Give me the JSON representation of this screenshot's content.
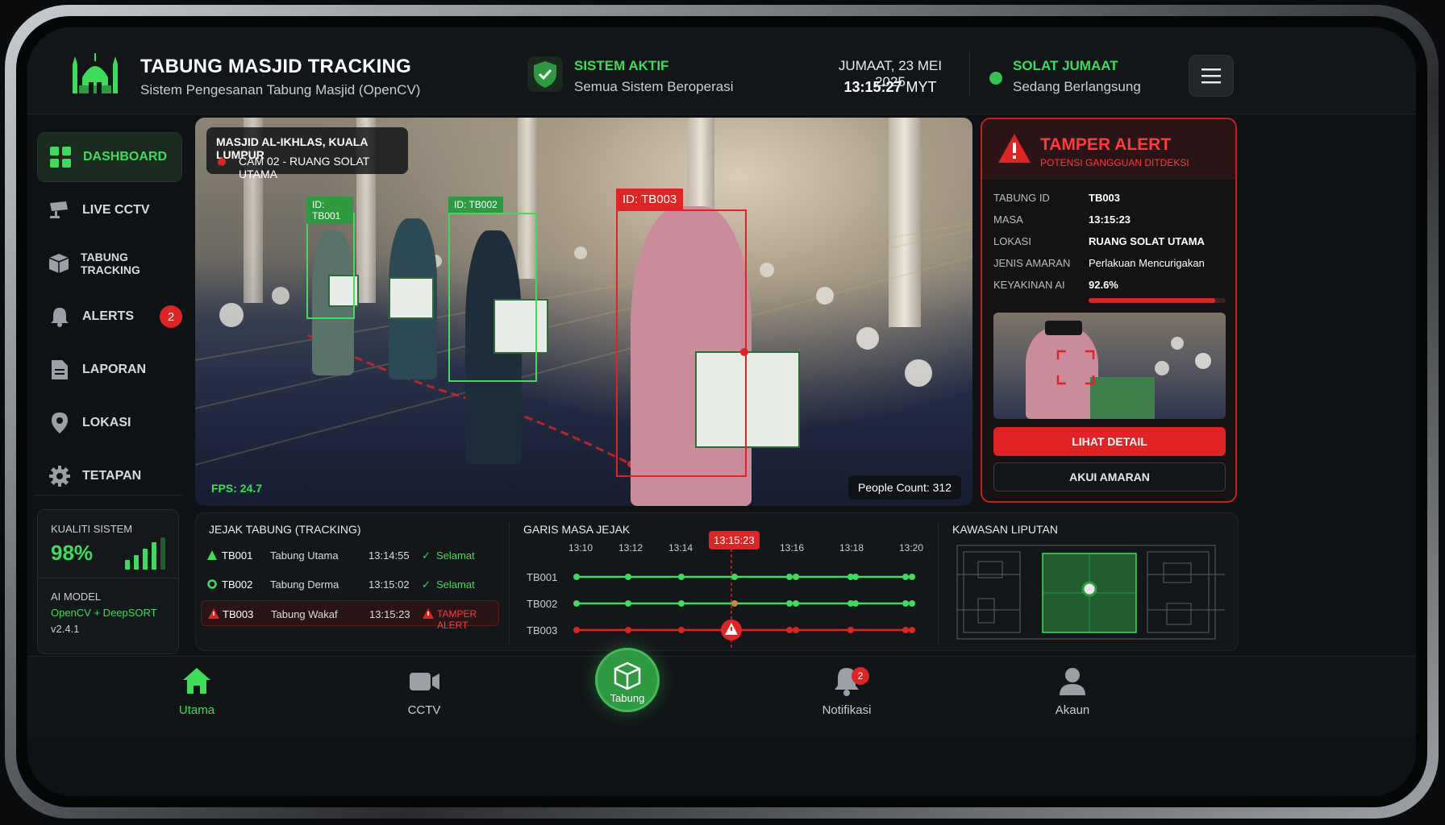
{
  "header": {
    "title": "TABUNG MASJID TRACKING",
    "subtitle": "Sistem Pengesanan Tabung Masjid (OpenCV)",
    "system_status": "SISTEM AKTIF",
    "system_status_sub": "Semua Sistem Beroperasi",
    "date": "JUMAAT, 23 MEI 2025",
    "time": "13:15:27",
    "timezone": "MYT",
    "prayer_status": "SOLAT JUMAAT",
    "prayer_sub": "Sedang Berlangsung"
  },
  "sidebar": {
    "items": [
      {
        "label": "DASHBOARD",
        "icon": "grid-icon",
        "active": true
      },
      {
        "label": "LIVE CCTV",
        "icon": "cctv-camera-icon"
      },
      {
        "label": "TABUNG TRACKING",
        "icon": "box-icon"
      },
      {
        "label": "ALERTS",
        "icon": "bell-icon",
        "badge": "2"
      },
      {
        "label": "LAPORAN",
        "icon": "document-icon"
      },
      {
        "label": "LOKASI",
        "icon": "location-pin-icon"
      },
      {
        "label": "TETAPAN",
        "icon": "gear-icon"
      }
    ],
    "quality_label": "KUALITI SISTEM",
    "quality_value": "98%",
    "ai_label": "AI MODEL",
    "ai_value": "OpenCV + DeepSORT",
    "ai_version": "v2.4.1"
  },
  "camera": {
    "location": "MASJID AL-IKHLAS, KUALA LUMPUR",
    "cam_id": "CAM 02 - RUANG SOLAT UTAMA",
    "boxes": [
      {
        "tag": "ID: TB001"
      },
      {
        "tag": "ID: TB002"
      },
      {
        "tag": "ID: TB003"
      }
    ],
    "fps": "FPS: 24.7",
    "people_count": "People Count: 312"
  },
  "alert": {
    "title": "TAMPER ALERT",
    "subtitle": "POTENSI GANGGUAN DITDEKSI",
    "fields": [
      {
        "key": "TABUNG ID",
        "value": "TB003"
      },
      {
        "key": "MASA",
        "value": "13:15:23"
      },
      {
        "key": "LOKASI",
        "value": "RUANG SOLAT UTAMA"
      },
      {
        "key": "JENIS AMARAN",
        "value": "Perlakuan Mencurigakan"
      },
      {
        "key": "KEYAKINAN AI",
        "value": "92.6%"
      }
    ],
    "confidence": 0.926,
    "detail_button": "LIHAT DETAIL",
    "ack_button": "AKUI AMARAN"
  },
  "tracking": {
    "title": "JEJAK TABUNG (TRACKING)",
    "rows": [
      {
        "id": "TB001",
        "name": "Tabung Utama",
        "time": "13:14:55",
        "status": "Selamat"
      },
      {
        "id": "TB002",
        "name": "Tabung Derma",
        "time": "13:15:02",
        "status": "Selamat"
      },
      {
        "id": "TB003",
        "name": "Tabung Wakaf",
        "time": "13:15:23",
        "status": "TAMPER ALERT"
      }
    ]
  },
  "timeline": {
    "title": "GARIS MASA JEJAK",
    "ticks": [
      "13:10",
      "13:12",
      "13:14",
      "13:16",
      "13:18",
      "13:20"
    ],
    "current": "13:15:23",
    "tracks": [
      "TB001",
      "TB002",
      "TB003"
    ]
  },
  "coverage": {
    "title": "KAWASAN LIPUTAN"
  },
  "bottom_nav": {
    "items": [
      {
        "label": "Utama",
        "icon": "home-icon"
      },
      {
        "label": "CCTV",
        "icon": "video-camera-icon"
      },
      {
        "label": "Tabung",
        "icon": "box-icon"
      },
      {
        "label": "Notifikasi",
        "icon": "bell-icon",
        "badge": "2"
      },
      {
        "label": "Akaun",
        "icon": "user-icon"
      }
    ]
  },
  "colors": {
    "accent": "#3ddc5a",
    "alert": "#e02424",
    "background": "#0f1215"
  }
}
